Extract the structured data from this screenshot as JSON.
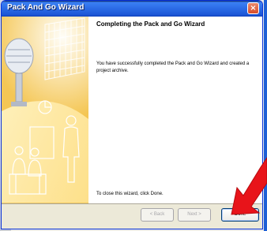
{
  "window": {
    "title": "Pack And Go Wizard",
    "close_label": "×"
  },
  "main": {
    "heading": "Completing the Pack and Go Wizard",
    "message": "You have successfully completed the Pack and Go Wizard and created a project archive.",
    "close_note": "To close this wizard, click Done."
  },
  "buttons": {
    "back_label": "< Back",
    "next_label": "Next >",
    "done_label": "Done"
  },
  "colors": {
    "titlebar": "#2b6be6",
    "annotation_arrow": "#e8141a",
    "sidebar_accent": "#f6b62a"
  }
}
